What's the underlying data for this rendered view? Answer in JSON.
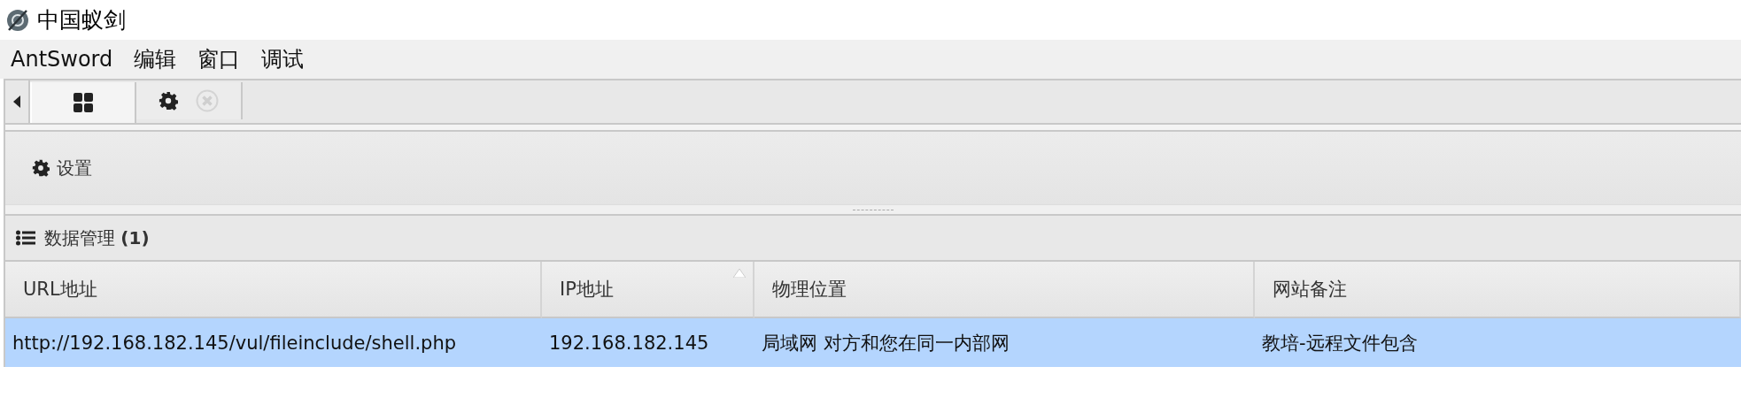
{
  "window": {
    "title": "中国蚁剑"
  },
  "menu": [
    "AntSword",
    "编辑",
    "窗口",
    "调试"
  ],
  "tabs": [
    {
      "kind": "home",
      "selected": true
    },
    {
      "kind": "settings",
      "selected": false,
      "closable": true
    }
  ],
  "toolbar": {
    "button": "设置"
  },
  "panel": {
    "title": "数据管理",
    "count": "(1)"
  },
  "table": {
    "columns": [
      {
        "label": "URL地址",
        "sorted": false
      },
      {
        "label": "IP地址",
        "sorted": true
      },
      {
        "label": "物理位置",
        "sorted": false
      },
      {
        "label": "网站备注",
        "sorted": false
      }
    ],
    "rows": [
      {
        "selected": true,
        "cells": [
          "http://192.168.182.145/vul/fileinclude/shell.php",
          "192.168.182.145",
          "局域网 对方和您在同一内部网",
          "教培-远程文件包含"
        ]
      }
    ]
  }
}
